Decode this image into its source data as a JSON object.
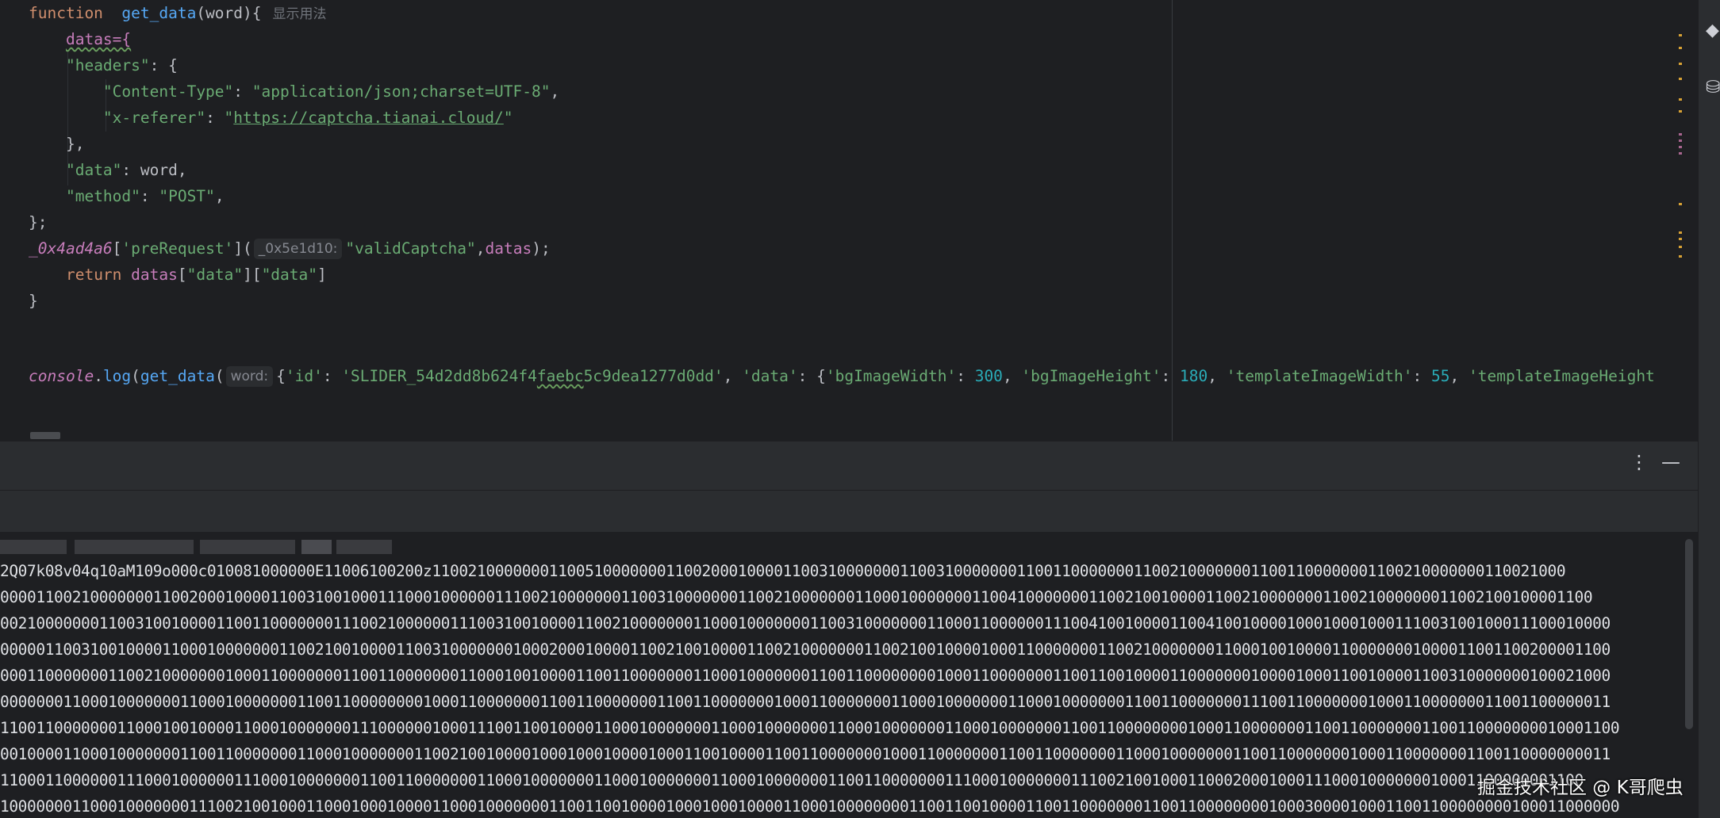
{
  "editor": {
    "line1": {
      "kw": "function",
      "name": "get_data",
      "params": "(word){",
      "usage_hint": "显示用法"
    },
    "line2": {
      "text": "datas={"
    },
    "line3": {
      "key": "\"headers\"",
      "rest": ": {"
    },
    "line4": {
      "key": "\"Content-Type\"",
      "colon": ": ",
      "value": "\"application/json;charset=UTF-8\"",
      "comma": ","
    },
    "line5": {
      "key": "\"x-referer\"",
      "colon": ": ",
      "quote_open": "\"",
      "url": "https://captcha.tianai.cloud/",
      "quote_close": "\""
    },
    "line6": {
      "text": "},"
    },
    "line7": {
      "key": "\"data\"",
      "rest": ": word,"
    },
    "line8": {
      "key": "\"method\"",
      "colon": ": ",
      "value": "\"POST\"",
      "comma": ","
    },
    "line9": {
      "text": "};"
    },
    "line10": {
      "obj": "_0x4ad4a6",
      "br_open": "[",
      "method": "'preRequest'",
      "br_close": "](",
      "hint": "_0x5e1d10:",
      "arg": "\"validCaptcha\"",
      "comma": ",",
      "var": "datas",
      "end": ");"
    },
    "line11": {
      "kw": "return",
      "var": "datas",
      "b1": "[",
      "k1": "\"data\"",
      "b2": "][",
      "k2": "\"data\"",
      "b3": "]"
    },
    "line12": {
      "text": "}"
    },
    "line14": {
      "obj": "console",
      "dot": ".",
      "log": "log",
      "p1": "(",
      "fn": "get_data",
      "p2": "(",
      "hint": "word:",
      "brace": "{",
      "k_id": "'id'",
      "c1": ": ",
      "v_id_a": "'SLIDER_54d2dd8b624f4",
      "v_id_b": "faebc",
      "v_id_c": "5c9dea1277d0dd'",
      "c2": ", ",
      "k_data": "'data'",
      "c3": ": {",
      "k_bgw": "'bgImageWidth'",
      "c4": ": ",
      "v_bgw": "300",
      "c5": ", ",
      "k_bgh": "'bgImageHeight'",
      "c6": ": ",
      "v_bgh": "180",
      "c7": ", ",
      "k_tw": "'templateImageWidth'",
      "c8": ": ",
      "v_tw": "55",
      "c9": ", ",
      "k_th": "'templateImageHeight"
    }
  },
  "toolwindow": {
    "more_icon": "⋮",
    "minimize_icon": "—"
  },
  "console": {
    "lines": [
      "2Q07k08v04q10aM109o000c010081000000E11006100200z110021000000011005100000001100200010000110031000000011003100000001100110000000110021000000011001100000001100210000000110021000",
      "000011002100000001100200010000110031001000111000100000011100210000000110031000000011002100000001100010000000110041000000011002100100001100210000000110021000000011002100100001100",
      "00210000000110031001000011001100000001110021000000111003100100001100210000000110001000000011003100000001100011000000111004100100001100410010000100010001000111003100100011100010000",
      "00000110031001000011000100000001100210010000110031000000010002000100001100210010000110021000000011002100100001000110000000110021000000011000100100001100000001000011001100200001100",
      "00011000000011002100000001000110000000110011000000011000100100001100110000000110001000000011001100000000100011000000011001100100001100000001000010001100100001100310000000100021000",
      "00000001100010000000110001000000011001100000000100011000000011001100000001100110000000100011000000011000100000001100010000000110011000000011100110000000100011000000011001100000011",
      "110011000000011000100100001100010000000111000000100011100110010000110001000000011000100000001100010000000110001000000011001100000000100011000000011001100000001100110000000010001100",
      "00100001100010000000110011000000011000100000001100210010000100010001000010001100100001100110000000100011000000011001100000001100010000000110011000000010001100000001100110000000011",
      "11000110000001110001000000111000100000001100110000000110001000000011000100000001100010000000110011000000011100010000000111002100100011000200010001110001000000010001100000001100",
      "100000001100010000000111002100100011000100010000110001000000011001100100001000100010000110001000000001100110010000110011000000011001100000000100030000100011001100000000100011000000"
    ]
  },
  "watermark": "掘金技术社区 @ K哥爬虫"
}
